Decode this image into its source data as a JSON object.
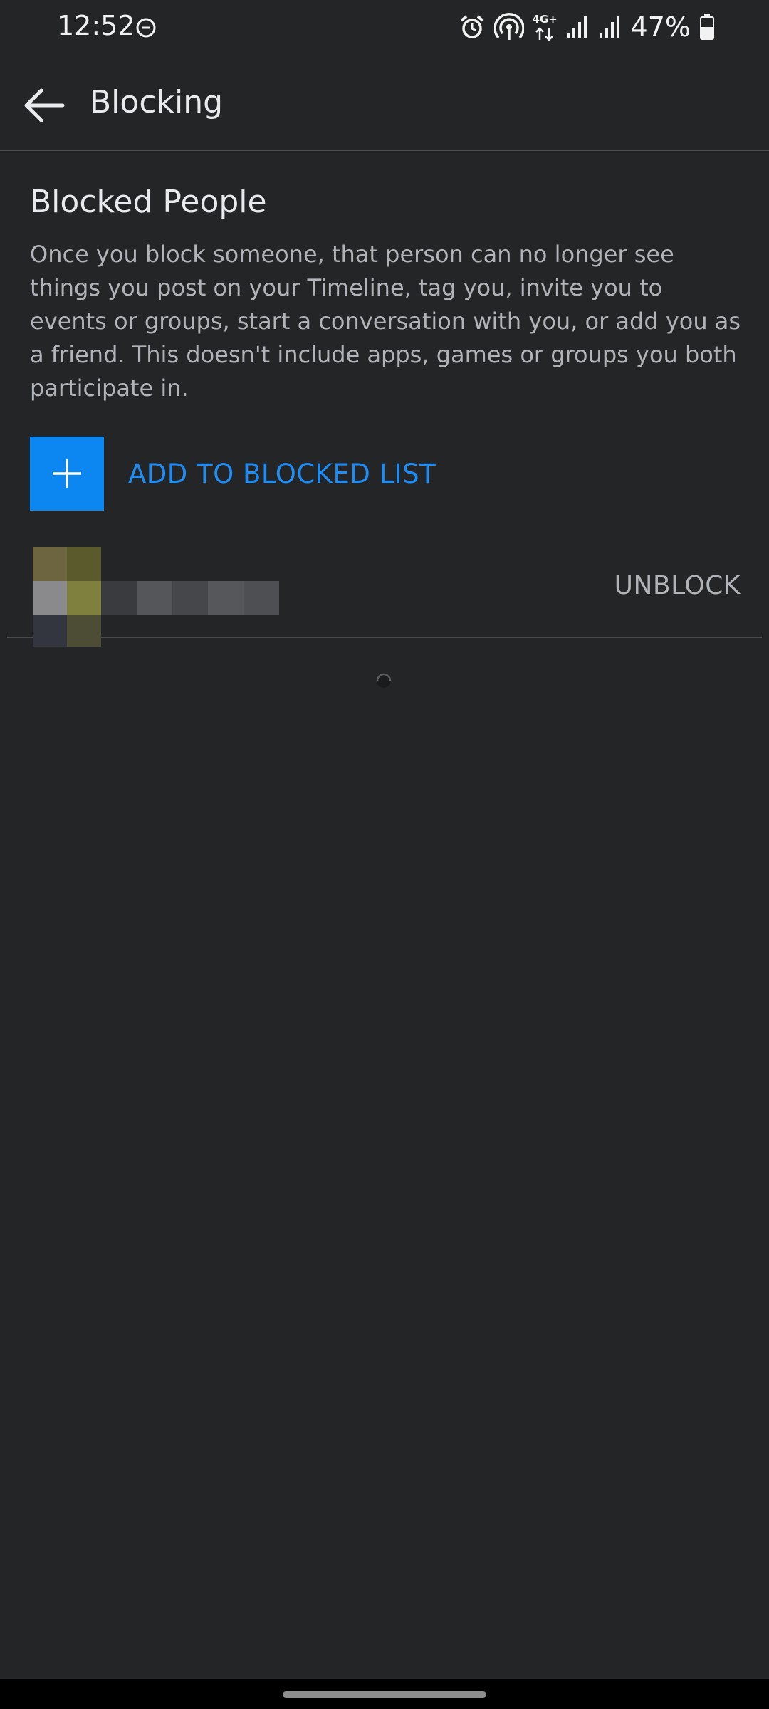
{
  "status_bar": {
    "time": "12:52",
    "network": "4G+",
    "battery_percent": "47%",
    "icons": [
      "do-not-disturb-icon",
      "alarm-icon",
      "hotspot-icon",
      "data-arrows-icon",
      "signal-icon",
      "signal-icon",
      "battery-icon"
    ]
  },
  "app_bar": {
    "title": "Blocking",
    "back_icon": "back-arrow-icon"
  },
  "section": {
    "title": "Blocked People",
    "description": "Once you block someone, that person can no longer see things you post on your Timeline, tag you, invite you to events or groups, start a conversation with you, or add you as a friend. This doesn't include apps, games or groups you both participate in."
  },
  "add_blocked": {
    "label": "ADD TO BLOCKED LIST",
    "icon": "plus-icon"
  },
  "blocked_list": [
    {
      "name": "",
      "action_label": "UNBLOCK"
    }
  ],
  "colors": {
    "background": "#242527",
    "accent": "#1f8cf3",
    "accent_fill": "#0c86f0",
    "secondary_text": "#b0b3b8"
  }
}
